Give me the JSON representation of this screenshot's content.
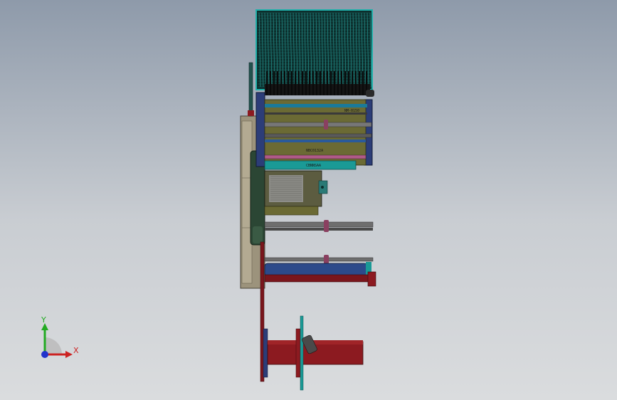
{
  "viewport": {
    "background_top": "#8e9aaa",
    "background_bottom": "#dadcde"
  },
  "model": {
    "component_labels": {
      "label_1": "NM-0150",
      "label_2": "NBC0132A",
      "label_3": "CBNNSAA"
    },
    "colors": {
      "frame_teal": "#1a9a96",
      "frame_blue": "#2c3d78",
      "plate_olive": "#6b6a34",
      "roller_red": "#8c1a20",
      "housing_beige": "#9c937c",
      "guard_green": "#2b4634",
      "pipe_gray": "#5a5a5a"
    }
  },
  "triad": {
    "x_label": "X",
    "y_label": "Y",
    "x_color": "#cc2222",
    "y_color": "#22aa22",
    "z_color": "#2233cc",
    "icon": "axis-triad-icon"
  }
}
